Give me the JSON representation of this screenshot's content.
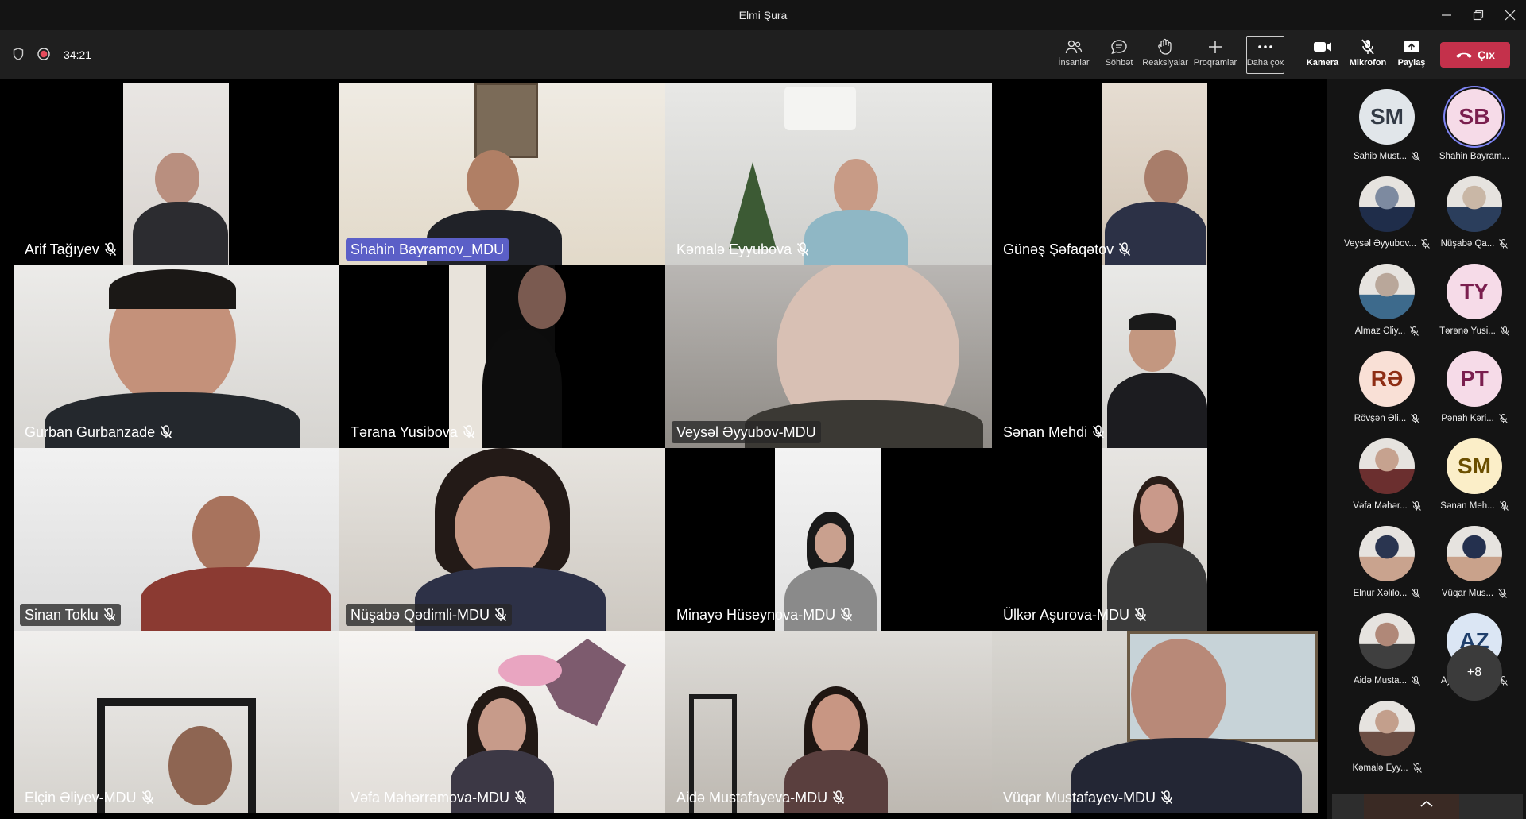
{
  "window": {
    "title": "Elmi Şura"
  },
  "meeting": {
    "timer": "34:21"
  },
  "toolbar": {
    "people_label": "İnsanlar",
    "chat_label": "Söhbət",
    "reactions_label": "Reaksiyalar",
    "apps_label": "Proqramlar",
    "more_label": "Daha çox",
    "camera_label": "Kamera",
    "mic_label": "Mikrofon",
    "share_label": "Paylaş",
    "leave_label": "Çıx"
  },
  "colors": {
    "leave": "#c4314b",
    "active_speaker": "#5b5fc7",
    "toolbar_bg": "#1f1f1f",
    "titlebar_bg": "#141414"
  },
  "tiles": [
    {
      "name": "Arif Tağıyev",
      "muted": true,
      "active": false
    },
    {
      "name": "Shahin Bayramov_MDU",
      "muted": false,
      "active": true
    },
    {
      "name": "Kəmalə Eyyubova",
      "muted": true,
      "active": false
    },
    {
      "name": "Günəş Şəfaqətov",
      "muted": true,
      "active": false
    },
    {
      "name": "Gurban Gurbanzade",
      "muted": true,
      "active": false
    },
    {
      "name": "Tərana Yusibova",
      "muted": true,
      "active": false
    },
    {
      "name": "Veysəl Əyyubov-MDU",
      "muted": false,
      "active": false
    },
    {
      "name": "Sənan Mehdi",
      "muted": true,
      "active": false
    },
    {
      "name": "Sinan Toklu",
      "muted": true,
      "active": false
    },
    {
      "name": "Nüşabə Qədimli-MDU",
      "muted": true,
      "active": false
    },
    {
      "name": "Minayə Hüseynova-MDU",
      "muted": true,
      "active": false
    },
    {
      "name": "Ülkər Aşurova-MDU",
      "muted": true,
      "active": false
    },
    {
      "name": "Elçin Əliyev-MDU",
      "muted": true,
      "active": false
    },
    {
      "name": "Vəfa Məhərrəmova-MDU",
      "muted": true,
      "active": false
    },
    {
      "name": "Aidə Mustafayeva-MDU",
      "muted": true,
      "active": false
    },
    {
      "name": "Vüqar Mustafayev-MDU",
      "muted": true,
      "active": false
    }
  ],
  "roster": [
    {
      "initials": "SM",
      "name": "Sahib Must...",
      "muted": true,
      "photo": false,
      "bg": "#e1e6ea",
      "fg": "#323a45"
    },
    {
      "initials": "SB",
      "name": "Shahin Bayram...",
      "muted": false,
      "photo": false,
      "bg": "#f6dbe8",
      "fg": "#7a1e4e",
      "speaking": true
    },
    {
      "initials": "",
      "name": "Veysəl Əyyubov...",
      "muted": true,
      "photo": true
    },
    {
      "initials": "",
      "name": "Nüşabə Qa...",
      "muted": true,
      "photo": true
    },
    {
      "initials": "",
      "name": "Almaz Əliy...",
      "muted": true,
      "photo": true
    },
    {
      "initials": "TY",
      "name": "Tərənə Yusi...",
      "muted": true,
      "photo": false,
      "bg": "#f6dbe8",
      "fg": "#7a1e4e"
    },
    {
      "initials": "RƏ",
      "name": "Rövşən Əli...",
      "muted": true,
      "photo": false,
      "bg": "#f9e0d6",
      "fg": "#8e2d14"
    },
    {
      "initials": "PT",
      "name": "Pənah Kəri...",
      "muted": true,
      "photo": false,
      "bg": "#f6dbe8",
      "fg": "#7a1e4e"
    },
    {
      "initials": "",
      "name": "Vəfa Məhər...",
      "muted": true,
      "photo": true
    },
    {
      "initials": "SM",
      "name": "Sənan Meh...",
      "muted": true,
      "photo": false,
      "bg": "#fbeec8",
      "fg": "#6b4f00"
    },
    {
      "initials": "",
      "name": "Elnur Xəlilo...",
      "muted": true,
      "photo": true
    },
    {
      "initials": "",
      "name": "Vüqar Mus...",
      "muted": true,
      "photo": true
    },
    {
      "initials": "",
      "name": "Aidə Musta...",
      "muted": true,
      "photo": true
    },
    {
      "initials": "AZ",
      "name": "Aynurə Zey...",
      "muted": true,
      "photo": false,
      "bg": "#dbe6f4",
      "fg": "#1f3f6b"
    },
    {
      "initials": "",
      "name": "Kəmalə Eyy...",
      "muted": true,
      "photo": true
    }
  ],
  "roster_overflow": "+8"
}
